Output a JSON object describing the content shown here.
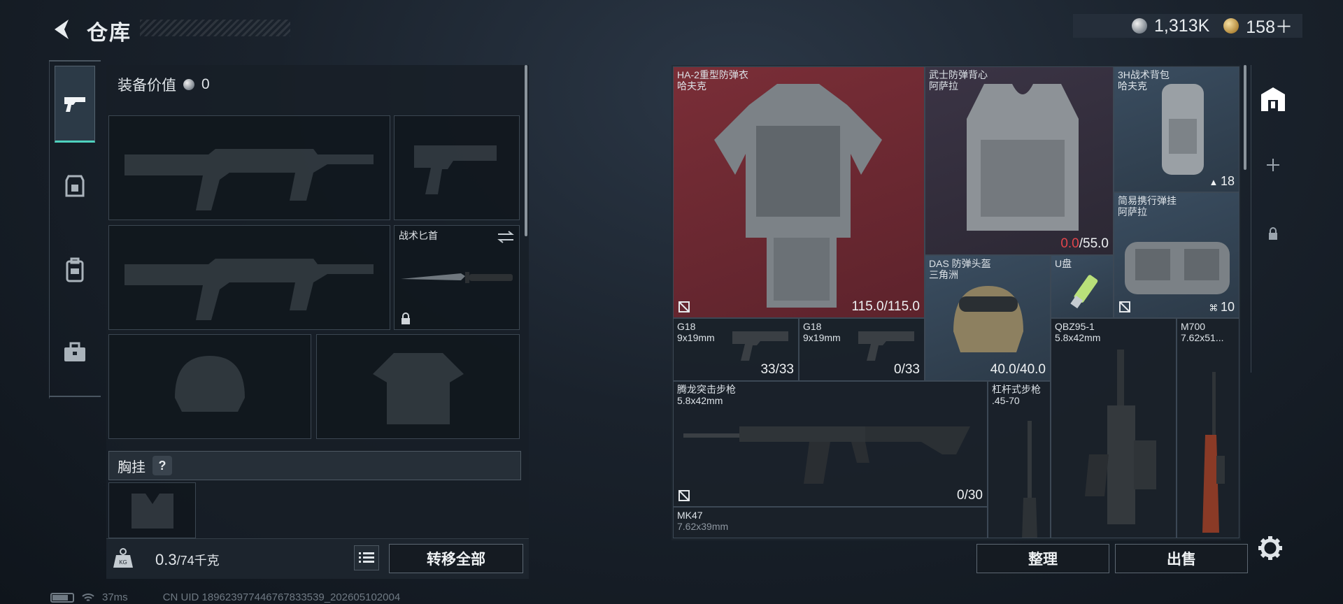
{
  "header": {
    "title": "仓库"
  },
  "currency": {
    "silver": "1,313K",
    "gold": "158＋"
  },
  "loadout": {
    "equip_value_label": "装备价值",
    "equip_value": "0",
    "knife_label": "战术匕首",
    "chest_rig_label": "胸挂",
    "help": "?",
    "weight_current": "0.3",
    "weight_max": "/74千克",
    "transfer_all": "转移全部"
  },
  "inventory": {
    "items": [
      {
        "name": "HA-2重型防弹衣",
        "sub": "哈夫克",
        "value": "115.0/115.0"
      },
      {
        "name": "武士防弹背心",
        "sub": "阿萨拉",
        "value_red": "0.0",
        "value": "/55.0"
      },
      {
        "name": "3H战术背包",
        "sub": "哈夫克",
        "value": "18"
      },
      {
        "name": "简易携行弹挂",
        "sub": "阿萨拉",
        "value": "10"
      },
      {
        "name": "DAS 防弹头盔",
        "sub": "三角洲",
        "value": "40.0/40.0"
      },
      {
        "name": "U盘",
        "sub": "",
        "value": ""
      },
      {
        "name": "G18",
        "sub": "9x19mm",
        "value": "33/33"
      },
      {
        "name": "G18",
        "sub": "9x19mm",
        "value": "0/33"
      },
      {
        "name": "QBZ95-1",
        "sub": "5.8x42mm",
        "value": ""
      },
      {
        "name": "M700",
        "sub": "7.62x51...",
        "value": ""
      },
      {
        "name": "腾龙突击步枪",
        "sub": "5.8x42mm",
        "value": "0/30"
      },
      {
        "name": "杠杆式步枪",
        "sub": ".45-70",
        "value": ""
      },
      {
        "name": "MK47",
        "sub": "7.62x39mm",
        "value": ""
      }
    ],
    "sort": "整理",
    "sell": "出售"
  },
  "status": {
    "ping": "37ms",
    "uid": "CN UID 18962397744676783353​9_202605102004"
  },
  "colors": {
    "accent": "#4fd2bf",
    "red_rarity": "#7a2e37",
    "purple_rarity": "#3b3445",
    "blue_rarity": "#3a4d60",
    "warning": "#e2454b"
  }
}
